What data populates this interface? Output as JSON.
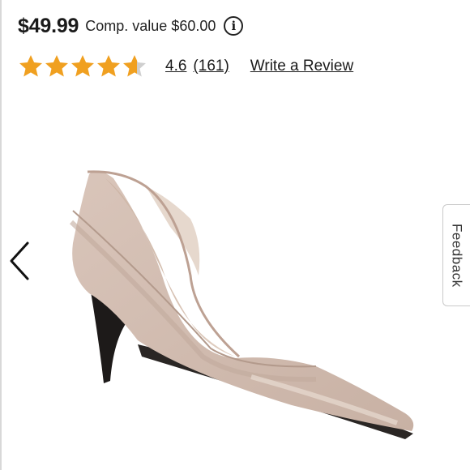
{
  "product": {
    "price": "$49.99",
    "comp_value": "Comp. value $60.00",
    "info_icon": "info-icon",
    "shoe_image": "nude-dorsay-pump-image"
  },
  "rating": {
    "stars_value": 4.6,
    "stars_max": 5,
    "star_color": "#f0a020",
    "star_empty_color": "#cfcfcf",
    "value_label": "4.6",
    "count_label": "(161)",
    "write_review_label": "Write a Review"
  },
  "gallery": {
    "prev_icon": "chevron-left-icon"
  },
  "feedback": {
    "label": "Feedback"
  }
}
